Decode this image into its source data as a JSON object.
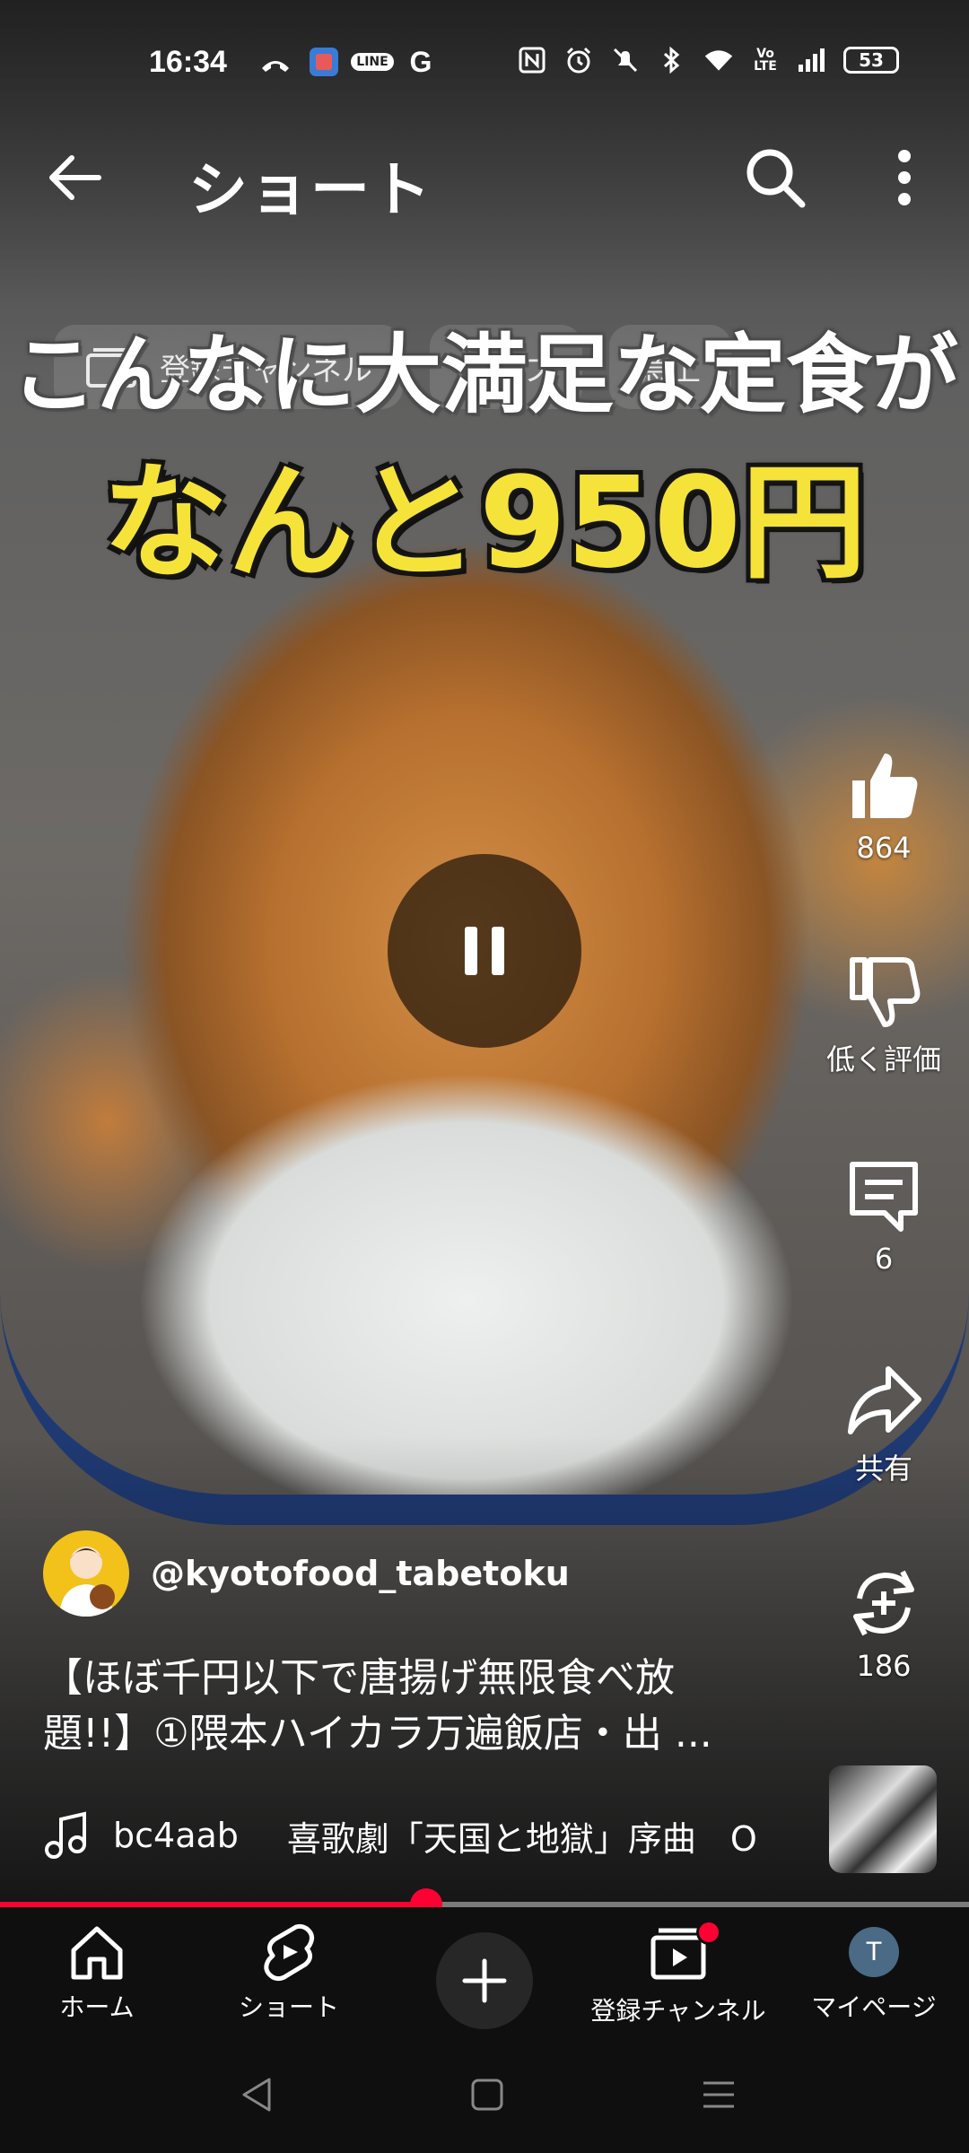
{
  "status_bar": {
    "time": "16:34",
    "line_badge": "LINE",
    "g_label": "G",
    "battery": "53"
  },
  "header": {
    "title": "ショート"
  },
  "filter_chips": [
    "登録チャンネル",
    "ライブ",
    "急上"
  ],
  "video": {
    "caption_line1": "こんなに大満足な定食が",
    "caption_line2": "なんと950円",
    "progress_percent": 44
  },
  "actions": {
    "like_count": "864",
    "dislike_label": "低く評価",
    "comment_count": "6",
    "share_label": "共有",
    "remix_count": "186"
  },
  "channel": {
    "handle": "@kyotofood_tabetoku"
  },
  "description": {
    "line1": "【ほぼ千円以下で唐揚げ無限食べ放",
    "line2": "題!!】①隈本ハイカラ万遍飯店・出 ..."
  },
  "music": {
    "id": "bc4aab",
    "title": "喜歌劇「天国と地獄」序曲　O"
  },
  "bottom_nav": {
    "home": "ホーム",
    "shorts": "ショート",
    "subscriptions": "登録チャンネル",
    "mypage": "マイページ",
    "avatar_letter": "T"
  },
  "colors": {
    "accent_red": "#ff0033",
    "caption_yellow": "#f6e33a",
    "nav_bg": "#0f0f0f"
  }
}
